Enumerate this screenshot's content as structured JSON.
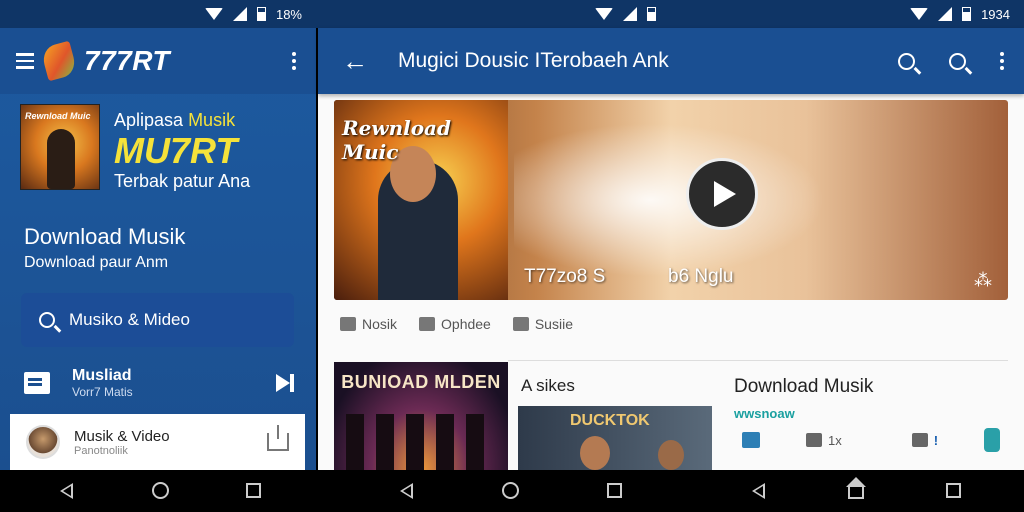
{
  "status": {
    "left": "18%",
    "right": "1934"
  },
  "drawer": {
    "logo": "777RT",
    "promo": {
      "line1_a": "Aplipasa",
      "line1_b": "Musik",
      "line2": "MU7RT",
      "line3": "Terbak patur Ana",
      "poster_caption": "Rewnload Muic"
    },
    "download_title": "Download Musik",
    "download_sub": "Download paur Anm",
    "search_label": "Musiko & Mideo",
    "item": {
      "title": "Musliad",
      "sub": "Vorr7 Matis"
    },
    "card": {
      "title": "Musik & Video",
      "sub": "Panotnoliik"
    }
  },
  "panel": {
    "title": "Mugici Dousic ITerobaeh Ank",
    "hero": {
      "poster_caption": "Rewnload Muic",
      "left_text": "T77zo8 S",
      "right_text": "b6 Nglu"
    },
    "actions": [
      "Nosik",
      "Ophdee",
      "Susiie"
    ],
    "card2_caption": "BUNIOAD MLDEN",
    "section_label": "A sikes",
    "card3_caption": "DUCKTOK",
    "download_title": "Download Musik",
    "download_sub": "wwsnoaw",
    "stats": {
      "s2": "1x",
      "s3": "!"
    }
  },
  "colors": {
    "appbar": "#1a4f92",
    "drawer": "#1d5aa0",
    "accent_yellow": "#f5e23a"
  }
}
